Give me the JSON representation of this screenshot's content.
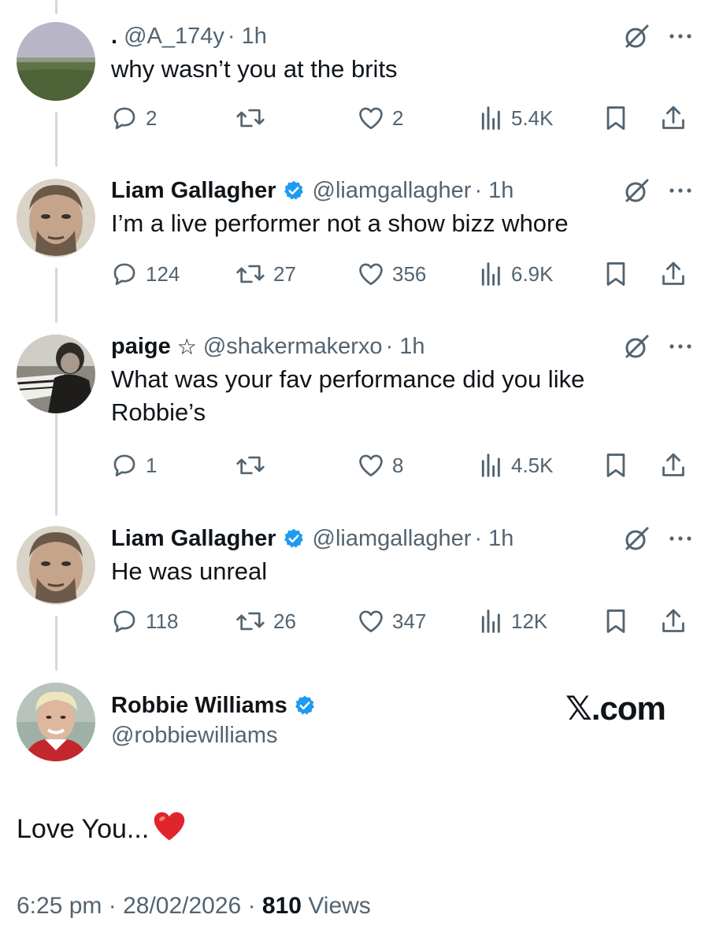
{
  "tweets": [
    {
      "display_name": ".",
      "verified": false,
      "star": false,
      "handle": "@A_174y",
      "time": "· 1h",
      "text": "why wasn’t you at the brits",
      "replies": "2",
      "reposts": "",
      "likes": "2",
      "views": "5.4K"
    },
    {
      "display_name": "Liam Gallagher",
      "verified": true,
      "star": false,
      "handle": "@liamgallagher",
      "time": "· 1h",
      "text": "I’m a live performer not a show bizz whore",
      "replies": "124",
      "reposts": "27",
      "likes": "356",
      "views": "6.9K"
    },
    {
      "display_name": "paige",
      "verified": false,
      "star": true,
      "star_glyph": "☆",
      "handle": "@shakermakerxo",
      "time": "· 1h",
      "text": "What was your fav performance did you like Robbie’s",
      "replies": "1",
      "reposts": "",
      "likes": "8",
      "views": "4.5K"
    },
    {
      "display_name": "Liam Gallagher",
      "verified": true,
      "star": false,
      "handle": "@liamgallagher",
      "time": "· 1h",
      "text": "He was unreal",
      "replies": "118",
      "reposts": "26",
      "likes": "347",
      "views": "12K"
    }
  ],
  "main_tweet": {
    "display_name": "Robbie Williams",
    "verified": true,
    "handle": "@robbiewilliams",
    "brand": "𝕏.com",
    "text": "Love You...",
    "time": "6:25 pm",
    "date": "28/02/2026",
    "views_count": "810",
    "views_label": "Views"
  },
  "colors": {
    "verified_badge": "#1d9bf0",
    "secondary_text": "#536471",
    "thread_line": "#cfd9de",
    "heart_emoji": "#e0242c"
  },
  "icons": [
    "grok-icon",
    "more-icon",
    "reply-icon",
    "repost-icon",
    "like-icon",
    "views-icon",
    "bookmark-icon",
    "share-icon",
    "verified-badge-icon",
    "red-heart-emoji-icon"
  ]
}
